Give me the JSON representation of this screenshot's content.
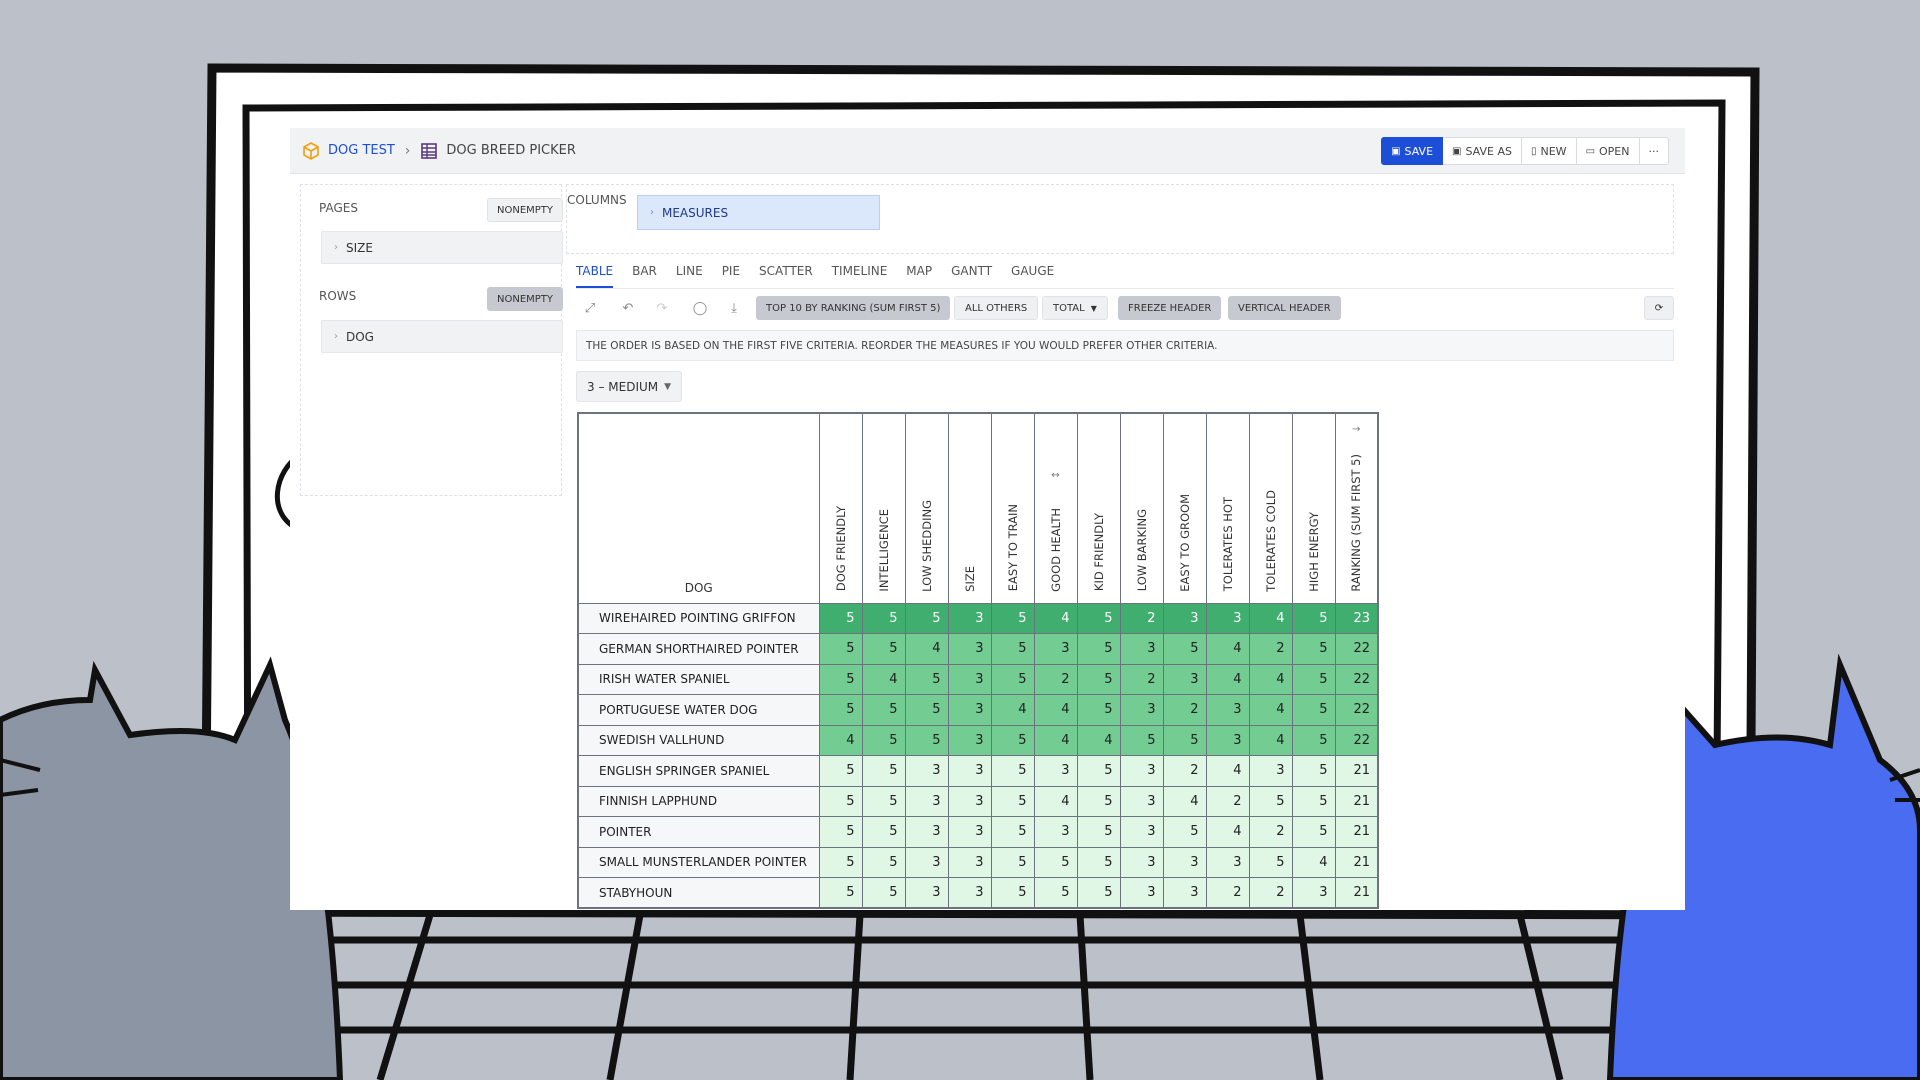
{
  "app": {
    "breadcrumb": [
      "DOG TEST",
      "DOG BREED PICKER"
    ],
    "actions": [
      "SAVE",
      "SAVE AS",
      "NEW",
      "OPEN",
      "···"
    ]
  },
  "pivot": {
    "pages": {
      "title": "PAGES",
      "toggle": "NONEMPTY",
      "dimension": "SIZE"
    },
    "rows": {
      "title": "ROWS",
      "toggle": "NONEMPTY",
      "dimension": "DOG"
    },
    "columns": {
      "title": "COLUMNS",
      "chip": "MEASURES"
    }
  },
  "tabs": [
    "TABLE",
    "BAR",
    "LINE",
    "PIE",
    "SCATTER",
    "TIMELINE",
    "MAP",
    "GANTT",
    "GAUGE"
  ],
  "toolbar": {
    "top10": "TOP 10 BY RANKING (SUM FIRST 5)",
    "all_others": "ALL OTHERS",
    "total": "TOTAL",
    "freeze_header": "FREEZE HEADER",
    "vertical_header": "VERTICAL HEADER"
  },
  "info": "THE ORDER IS BASED ON THE FIRST FIVE CRITERIA. REORDER THE MEASURES IF YOU WOULD PREFER OTHER CRITERIA.",
  "filter": "3 – MEDIUM",
  "table": {
    "row_header": "DOG",
    "columns": [
      "DOG FRIENDLY",
      "INTELLIGENCE",
      "LOW SHEDDING",
      "SIZE",
      "EASY TO TRAIN",
      "GOOD HEALTH",
      "KID FRIENDLY",
      "LOW BARKING",
      "EASY TO GROOM",
      "TOLERATES HOT",
      "TOLERATES COLD",
      "HIGH ENERGY",
      "RANKING (SUM FIRST 5)"
    ],
    "rows": [
      {
        "name": "WIREHAIRED POINTING GRIFFON",
        "values": [
          5,
          5,
          5,
          3,
          5,
          4,
          5,
          2,
          3,
          3,
          4,
          5,
          23
        ]
      },
      {
        "name": "GERMAN SHORTHAIRED POINTER",
        "values": [
          5,
          5,
          4,
          3,
          5,
          3,
          5,
          3,
          5,
          4,
          2,
          5,
          22
        ]
      },
      {
        "name": "IRISH WATER SPANIEL",
        "values": [
          5,
          4,
          5,
          3,
          5,
          2,
          5,
          2,
          3,
          4,
          4,
          5,
          22
        ]
      },
      {
        "name": "PORTUGUESE WATER DOG",
        "values": [
          5,
          5,
          5,
          3,
          4,
          4,
          5,
          3,
          2,
          3,
          4,
          5,
          22
        ]
      },
      {
        "name": "SWEDISH VALLHUND",
        "values": [
          4,
          5,
          5,
          3,
          5,
          4,
          4,
          5,
          5,
          3,
          4,
          5,
          22
        ]
      },
      {
        "name": "ENGLISH SPRINGER SPANIEL",
        "values": [
          5,
          5,
          3,
          3,
          5,
          3,
          5,
          3,
          2,
          4,
          3,
          5,
          21
        ]
      },
      {
        "name": "FINNISH LAPPHUND",
        "values": [
          5,
          5,
          3,
          3,
          5,
          4,
          5,
          3,
          4,
          2,
          5,
          5,
          21
        ]
      },
      {
        "name": "POINTER",
        "values": [
          5,
          5,
          3,
          3,
          5,
          3,
          5,
          3,
          5,
          4,
          2,
          5,
          21
        ]
      },
      {
        "name": "SMALL MUNSTERLANDER POINTER",
        "values": [
          5,
          5,
          3,
          3,
          5,
          5,
          5,
          3,
          3,
          3,
          5,
          4,
          21
        ]
      },
      {
        "name": "STABYHOUN",
        "values": [
          5,
          5,
          3,
          3,
          5,
          5,
          5,
          3,
          3,
          2,
          2,
          3,
          21
        ]
      }
    ]
  },
  "colors": {
    "accent": "#1d4ed8",
    "tier1": "#3fae6f",
    "tier2": "#73cc92",
    "tier3": "#e0f7e6",
    "blue_cat": "#4a6cf0",
    "gray_cat": "#8c95a3"
  }
}
